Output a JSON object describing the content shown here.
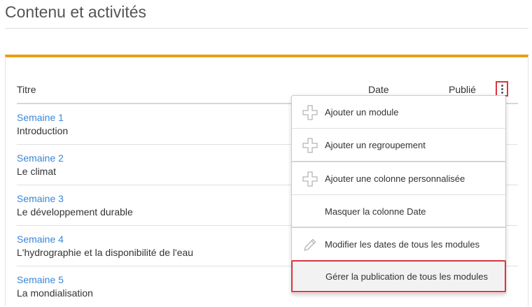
{
  "page": {
    "title": "Contenu et activités"
  },
  "table": {
    "headers": {
      "title": "Titre",
      "date": "Date",
      "published": "Publié"
    },
    "rows": [
      {
        "week": "Semaine 1",
        "name": "Introduction"
      },
      {
        "week": "Semaine 2",
        "name": "Le climat"
      },
      {
        "week": "Semaine 3",
        "name": "Le développement durable"
      },
      {
        "week": "Semaine 4",
        "name": "L'hydrographie et la disponibilité de l'eau"
      },
      {
        "week": "Semaine 5",
        "name": "La mondialisation"
      }
    ]
  },
  "menu": {
    "items": [
      {
        "label": "Ajouter un module",
        "icon": "plus-icon"
      },
      {
        "label": "Ajouter un regroupement",
        "icon": "plus-icon"
      },
      {
        "label": "Ajouter une colonne personnalisée",
        "icon": "plus-icon"
      },
      {
        "label": "Masquer la colonne Date",
        "icon": ""
      },
      {
        "label": "Modifier les dates de tous les modules",
        "icon": "pencil-icon"
      },
      {
        "label": "Gérer la publication de tous les modules",
        "icon": ""
      }
    ]
  },
  "colors": {
    "accent": "#e8a016",
    "link": "#3a87d8",
    "highlight": "#d9363e"
  }
}
